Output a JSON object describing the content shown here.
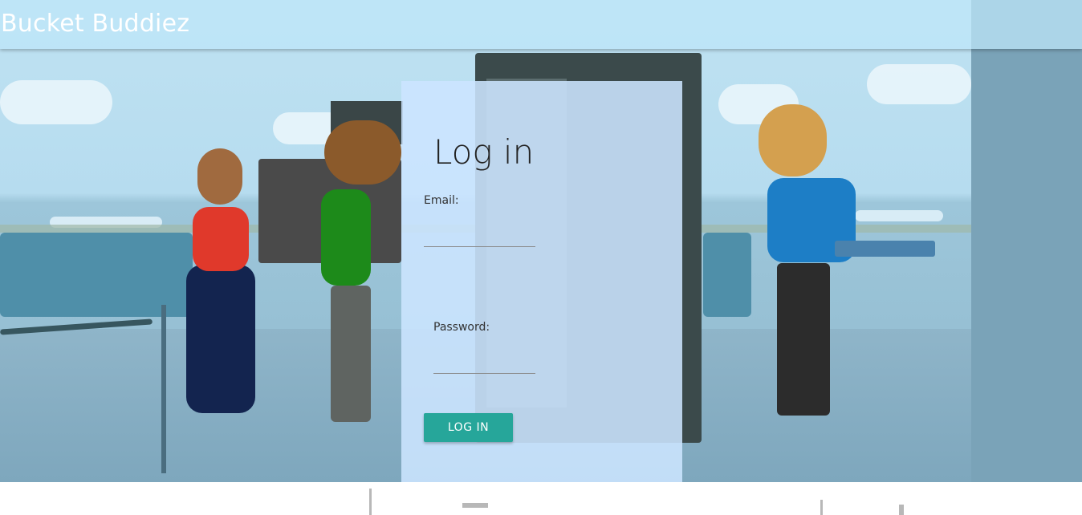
{
  "header": {
    "title": "Bucket Buddiez"
  },
  "login": {
    "heading": "Log in",
    "email_label": "Email:",
    "email_value": "",
    "password_label": "Password:",
    "password_value": "",
    "button_label": "LOG IN"
  },
  "colors": {
    "accent": "#26a69a",
    "panel": "#cce5ff",
    "header": "#bee6f8"
  }
}
